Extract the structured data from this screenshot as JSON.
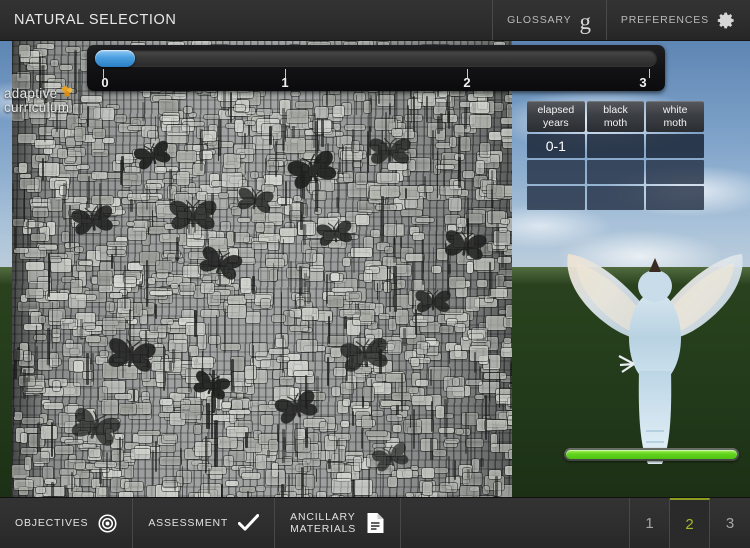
{
  "header": {
    "title": "NATURAL SELECTION",
    "glossary_label": "GLOSSARY",
    "glossary_icon": "glossary-g-icon",
    "preferences_label": "PREFERENCES",
    "preferences_icon": "gear-icon"
  },
  "logo": {
    "line1": "adaptive",
    "line2": "curriculum",
    "accent_color": "#e8a01e"
  },
  "timeline": {
    "value": 0,
    "min": 0,
    "max": 3,
    "ticks": [
      "0",
      "1",
      "2",
      "3"
    ],
    "handle_color": "#4a9fe0"
  },
  "data_table": {
    "headers": [
      "elapsed years",
      "black moth",
      "white moth"
    ],
    "headers_split": [
      [
        "elapsed",
        "years"
      ],
      [
        "black",
        "moth"
      ],
      [
        "white",
        "moth"
      ]
    ],
    "rows": [
      [
        "0-1",
        "",
        ""
      ],
      [
        "",
        "",
        ""
      ],
      [
        "",
        "",
        ""
      ]
    ]
  },
  "simulation": {
    "reset_icon": "reset-refresh-icon",
    "reset_color": "#f4662a",
    "energy_bar_percent": 100,
    "energy_bar_color": "#62d41e",
    "bird_name": "predator-bird",
    "trunk_name": "tree-trunk-bark",
    "moth_count": 14
  },
  "footer": {
    "objectives_label": "OBJECTIVES",
    "objectives_icon": "target-icon",
    "assessment_label": "ASSESSMENT",
    "assessment_icon": "checkmark-icon",
    "ancillary_label_line1": "ANCILLARY",
    "ancillary_label_line2": "MATERIALS",
    "ancillary_icon": "document-icon",
    "pages": [
      "1",
      "2",
      "3"
    ],
    "active_page": "2",
    "active_color": "#a8b82c"
  }
}
